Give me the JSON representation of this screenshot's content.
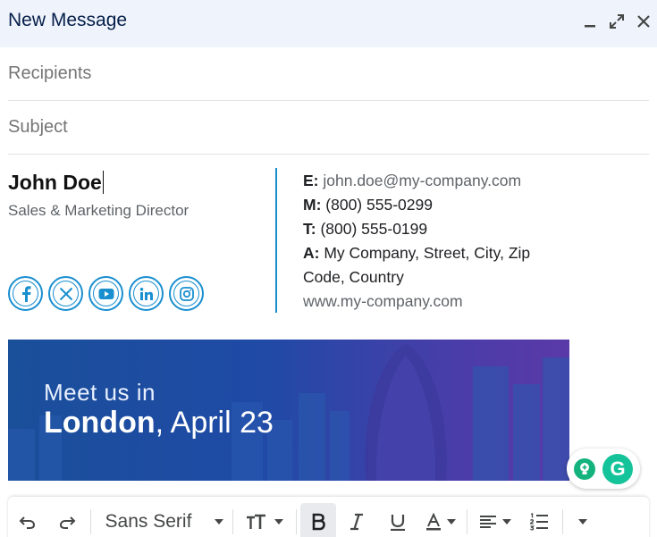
{
  "header": {
    "title": "New Message"
  },
  "recipients": {
    "placeholder": "Recipients"
  },
  "subject": {
    "placeholder": "Subject"
  },
  "signature": {
    "name": "John Doe",
    "title": "Sales & Marketing Director",
    "contact": {
      "email_label": "E:",
      "email": "john.doe@my-company.com",
      "mobile_label": "M:",
      "mobile": "(800) 555-0299",
      "phone_label": "T:",
      "phone": "(800) 555-0199",
      "address_label": "A:",
      "address": "My Company, Street, City, Zip Code, Country",
      "website": "www.my-company.com"
    },
    "social_icons": [
      "facebook-icon",
      "x-icon",
      "youtube-icon",
      "linkedin-icon",
      "instagram-icon"
    ],
    "accent_color": "#1a8fd0"
  },
  "banner": {
    "line1": "Meet us in",
    "city": "London",
    "date": ", April 23"
  },
  "toolbar": {
    "font": "Sans Serif"
  },
  "addon": {
    "letter": "G"
  }
}
